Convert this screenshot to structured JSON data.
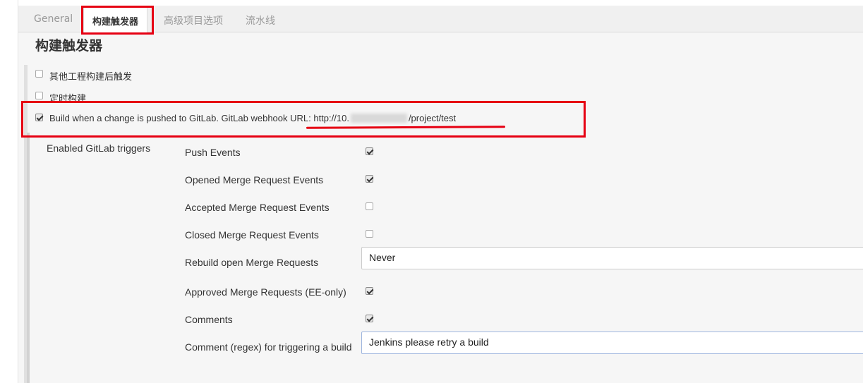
{
  "tabs": [
    {
      "label": "General"
    },
    {
      "label": "构建触发器"
    },
    {
      "label": "高级项目选项"
    },
    {
      "label": "流水线"
    }
  ],
  "section_title": "构建触发器",
  "triggers": [
    {
      "label": "其他工程构建后触发",
      "checked": false
    },
    {
      "label": "定时构建",
      "checked": false
    },
    {
      "label_prefix": "Build when a change is pushed to GitLab. GitLab webhook URL: http://10.",
      "label_suffix": "/project/test",
      "checked": true
    }
  ],
  "gitlab": {
    "group_label": "Enabled GitLab triggers",
    "events": [
      {
        "label": "Push Events",
        "checked": true
      },
      {
        "label": "Opened Merge Request Events",
        "checked": true
      },
      {
        "label": "Accepted Merge Request Events",
        "checked": false
      },
      {
        "label": "Closed Merge Request Events",
        "checked": false
      }
    ],
    "rebuild": {
      "label": "Rebuild open Merge Requests",
      "value": "Never"
    },
    "approved": {
      "label": "Approved Merge Requests (EE-only)",
      "checked": true
    },
    "comments": {
      "label": "Comments",
      "checked": true
    },
    "comment_regex": {
      "label": "Comment (regex) for triggering a build",
      "value": "Jenkins please retry a build"
    }
  },
  "colors": {
    "annotation": "#e60012",
    "panel": "#f6f6f6"
  }
}
